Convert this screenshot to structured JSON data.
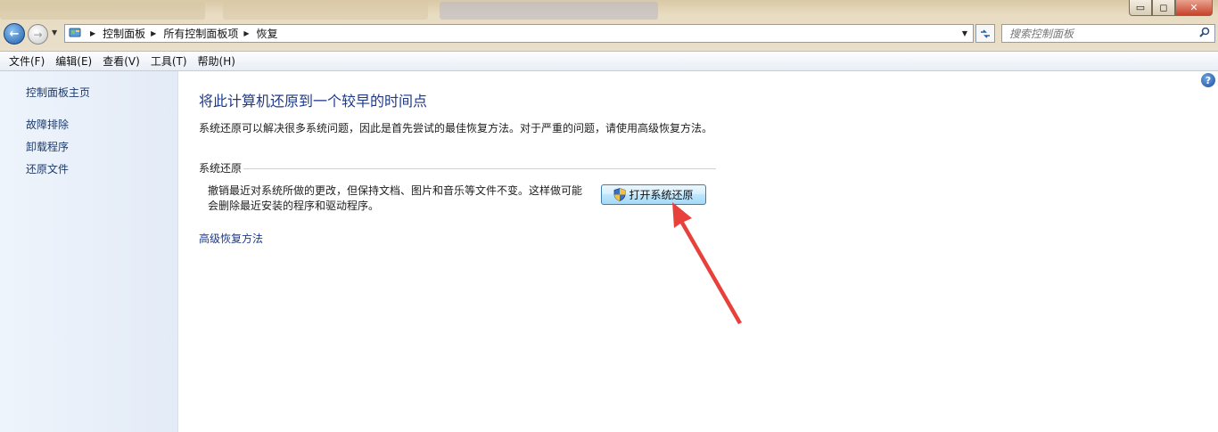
{
  "window": {
    "controls": {
      "minimize": "▭",
      "maximize": "◻",
      "close": "✕"
    }
  },
  "toolbar": {
    "back_glyph": "←",
    "forward_glyph": "→",
    "breadcrumbs": [
      "控制面板",
      "所有控制面板项",
      "恢复"
    ],
    "search_placeholder": "搜索控制面板"
  },
  "menu": [
    "文件(F)",
    "编辑(E)",
    "查看(V)",
    "工具(T)",
    "帮助(H)"
  ],
  "sidebar": {
    "home": "控制面板主页",
    "items": [
      "故障排除",
      "卸载程序",
      "还原文件"
    ]
  },
  "main": {
    "title": "将此计算机还原到一个较早的时间点",
    "description": "系统还原可以解决很多系统问题，因此是首先尝试的最佳恢复方法。对于严重的问题，请使用高级恢复方法。",
    "section_title": "系统还原",
    "section_text_line1": "撤销最近对系统所做的更改，但保持文档、图片和音乐等文件不变。这样做可能",
    "section_text_line2": "会删除最近安装的程序和驱动程序。",
    "button_label": "打开系统还原",
    "advanced_link": "高级恢复方法",
    "help_glyph": "?"
  },
  "colors": {
    "link": "#1e3a8a",
    "annotation_arrow": "#e8413c",
    "sidebar_bg": "#eaf1fa"
  }
}
